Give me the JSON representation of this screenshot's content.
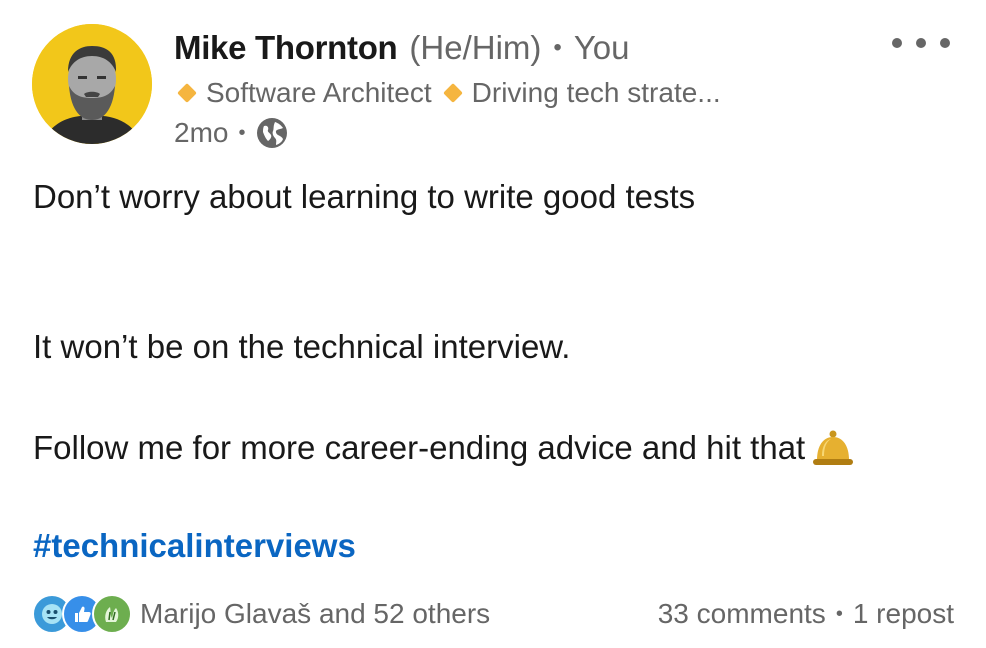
{
  "author": {
    "name": "Mike Thornton",
    "pronouns": "(He/Him)",
    "separator": "•",
    "relationship": "You",
    "headline_part1": "Software Architect",
    "headline_part2": "Driving tech strate..."
  },
  "meta": {
    "age": "2mo",
    "separator": "•",
    "visibility_icon": "globe-icon"
  },
  "post": {
    "line1": "Don’t worry about learning to write good tests",
    "line2": "It won’t be on the technical interview.",
    "line3": "Follow me for more career-ending advice and hit that",
    "line3_emoji": "bell-icon",
    "hashtag": "#technicalinterviews"
  },
  "social": {
    "reaction_icons": [
      "insightful-icon",
      "like-icon",
      "celebrate-icon"
    ],
    "reactors": "Marijo Glavaš and 52 others",
    "comments": "33 comments",
    "separator": "•",
    "reposts": "1 repost"
  },
  "colors": {
    "link": "#0a66c2",
    "secondary_text": "#666666",
    "avatar_bg": "#f2c71a",
    "diamond": "#f5b53f"
  }
}
